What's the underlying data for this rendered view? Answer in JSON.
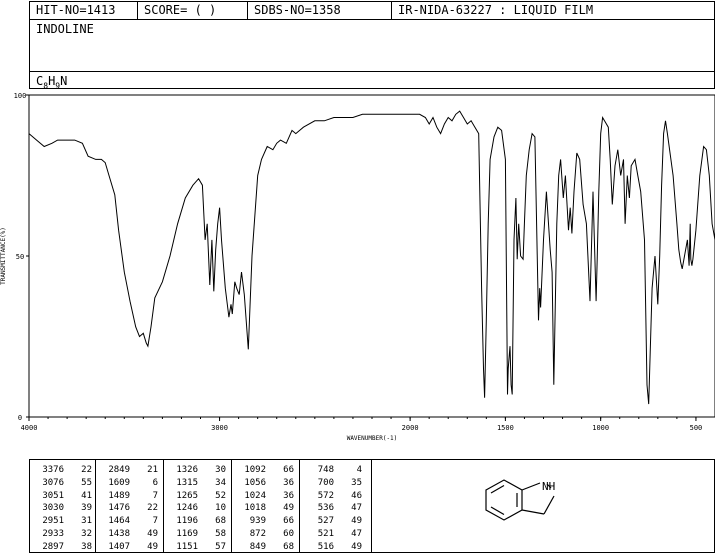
{
  "header": {
    "hit_no": "HIT-NO=1413",
    "score": "SCORE=  (  )",
    "sdbs_no": "SDBS-NO=1358",
    "ir_id": "IR-NIDA-63227 : LIQUID FILM",
    "compound_name": "INDOLINE",
    "formula_base": "C",
    "formula_parts": [
      {
        "t": "C",
        "s": false
      },
      {
        "t": "8",
        "s": true
      },
      {
        "t": "H",
        "s": false
      },
      {
        "t": "9",
        "s": true
      },
      {
        "t": "N",
        "s": false
      }
    ]
  },
  "chart_data": {
    "type": "line",
    "title": "",
    "xlabel": "WAVENUMBER(-1)",
    "ylabel": "TRANSMITTANCE(%)",
    "xlim": [
      4000,
      400
    ],
    "ylim": [
      0,
      100
    ],
    "x_ticks": [
      4000,
      3000,
      2000,
      1500,
      1000,
      500
    ],
    "x_tick_labels": [
      "4000",
      "3000",
      "2000",
      "1500",
      "1000",
      "500"
    ],
    "y_ticks": [
      0,
      50,
      100
    ],
    "y_tick_labels": [
      "0",
      "50",
      "100"
    ],
    "series": [
      {
        "name": "",
        "color": "#000000",
        "points": [
          [
            4000,
            88
          ],
          [
            3960,
            86
          ],
          [
            3920,
            84
          ],
          [
            3880,
            85
          ],
          [
            3850,
            86
          ],
          [
            3800,
            86
          ],
          [
            3760,
            86
          ],
          [
            3720,
            85
          ],
          [
            3690,
            81
          ],
          [
            3650,
            80
          ],
          [
            3620,
            80
          ],
          [
            3600,
            79
          ],
          [
            3580,
            75
          ],
          [
            3550,
            69
          ],
          [
            3530,
            58
          ],
          [
            3500,
            45
          ],
          [
            3470,
            36
          ],
          [
            3440,
            28
          ],
          [
            3420,
            25
          ],
          [
            3400,
            26
          ],
          [
            3385,
            23
          ],
          [
            3376,
            22
          ],
          [
            3360,
            28
          ],
          [
            3340,
            37
          ],
          [
            3300,
            42
          ],
          [
            3260,
            50
          ],
          [
            3220,
            60
          ],
          [
            3180,
            68
          ],
          [
            3140,
            72
          ],
          [
            3110,
            74
          ],
          [
            3090,
            72
          ],
          [
            3076,
            55
          ],
          [
            3065,
            60
          ],
          [
            3051,
            41
          ],
          [
            3040,
            55
          ],
          [
            3030,
            39
          ],
          [
            3020,
            52
          ],
          [
            3010,
            60
          ],
          [
            3000,
            65
          ],
          [
            2990,
            55
          ],
          [
            2970,
            40
          ],
          [
            2951,
            31
          ],
          [
            2940,
            35
          ],
          [
            2933,
            32
          ],
          [
            2920,
            42
          ],
          [
            2910,
            40
          ],
          [
            2897,
            38
          ],
          [
            2885,
            45
          ],
          [
            2870,
            38
          ],
          [
            2849,
            21
          ],
          [
            2830,
            50
          ],
          [
            2800,
            75
          ],
          [
            2780,
            80
          ],
          [
            2750,
            84
          ],
          [
            2720,
            83
          ],
          [
            2700,
            85
          ],
          [
            2680,
            86
          ],
          [
            2650,
            85
          ],
          [
            2620,
            89
          ],
          [
            2600,
            88
          ],
          [
            2560,
            90
          ],
          [
            2500,
            92
          ],
          [
            2450,
            92
          ],
          [
            2400,
            93
          ],
          [
            2350,
            93
          ],
          [
            2300,
            93
          ],
          [
            2250,
            94
          ],
          [
            2200,
            94
          ],
          [
            2150,
            94
          ],
          [
            2100,
            94
          ],
          [
            2050,
            94
          ],
          [
            2000,
            94
          ],
          [
            1950,
            94
          ],
          [
            1920,
            93
          ],
          [
            1900,
            91
          ],
          [
            1880,
            93
          ],
          [
            1860,
            90
          ],
          [
            1840,
            88
          ],
          [
            1820,
            91
          ],
          [
            1800,
            93
          ],
          [
            1780,
            92
          ],
          [
            1760,
            94
          ],
          [
            1740,
            95
          ],
          [
            1720,
            93
          ],
          [
            1700,
            91
          ],
          [
            1680,
            92
          ],
          [
            1660,
            90
          ],
          [
            1640,
            88
          ],
          [
            1625,
            40
          ],
          [
            1615,
            15
          ],
          [
            1609,
            6
          ],
          [
            1600,
            30
          ],
          [
            1590,
            60
          ],
          [
            1580,
            80
          ],
          [
            1560,
            87
          ],
          [
            1540,
            90
          ],
          [
            1520,
            89
          ],
          [
            1500,
            80
          ],
          [
            1489,
            7
          ],
          [
            1485,
            15
          ],
          [
            1476,
            22
          ],
          [
            1470,
            10
          ],
          [
            1464,
            7
          ],
          [
            1455,
            55
          ],
          [
            1445,
            68
          ],
          [
            1438,
            49
          ],
          [
            1430,
            60
          ],
          [
            1420,
            50
          ],
          [
            1407,
            49
          ],
          [
            1400,
            60
          ],
          [
            1390,
            75
          ],
          [
            1375,
            83
          ],
          [
            1360,
            88
          ],
          [
            1345,
            87
          ],
          [
            1326,
            30
          ],
          [
            1320,
            40
          ],
          [
            1315,
            34
          ],
          [
            1300,
            55
          ],
          [
            1285,
            70
          ],
          [
            1265,
            52
          ],
          [
            1255,
            45
          ],
          [
            1246,
            10
          ],
          [
            1230,
            60
          ],
          [
            1220,
            75
          ],
          [
            1210,
            80
          ],
          [
            1196,
            68
          ],
          [
            1185,
            75
          ],
          [
            1169,
            58
          ],
          [
            1160,
            65
          ],
          [
            1151,
            57
          ],
          [
            1140,
            70
          ],
          [
            1125,
            82
          ],
          [
            1110,
            80
          ],
          [
            1092,
            66
          ],
          [
            1075,
            60
          ],
          [
            1056,
            36
          ],
          [
            1040,
            70
          ],
          [
            1024,
            36
          ],
          [
            1018,
            49
          ],
          [
            1010,
            70
          ],
          [
            1000,
            88
          ],
          [
            990,
            93
          ],
          [
            980,
            92
          ],
          [
            960,
            90
          ],
          [
            950,
            80
          ],
          [
            939,
            66
          ],
          [
            925,
            78
          ],
          [
            910,
            83
          ],
          [
            895,
            75
          ],
          [
            880,
            80
          ],
          [
            872,
            60
          ],
          [
            860,
            75
          ],
          [
            849,
            68
          ],
          [
            840,
            78
          ],
          [
            820,
            80
          ],
          [
            805,
            75
          ],
          [
            790,
            70
          ],
          [
            770,
            55
          ],
          [
            757,
            10
          ],
          [
            748,
            4
          ],
          [
            740,
            20
          ],
          [
            730,
            40
          ],
          [
            715,
            50
          ],
          [
            700,
            35
          ],
          [
            690,
            50
          ],
          [
            680,
            72
          ],
          [
            670,
            88
          ],
          [
            660,
            92
          ],
          [
            650,
            88
          ],
          [
            620,
            75
          ],
          [
            600,
            60
          ],
          [
            590,
            52
          ],
          [
            580,
            48
          ],
          [
            572,
            46
          ],
          [
            560,
            50
          ],
          [
            545,
            55
          ],
          [
            536,
            47
          ],
          [
            530,
            60
          ],
          [
            527,
            49
          ],
          [
            521,
            47
          ],
          [
            516,
            49
          ],
          [
            500,
            58
          ],
          [
            480,
            75
          ],
          [
            460,
            84
          ],
          [
            445,
            83
          ],
          [
            430,
            75
          ],
          [
            415,
            60
          ],
          [
            400,
            55
          ]
        ]
      }
    ]
  },
  "peak_table": {
    "columns": [
      [
        [
          3376,
          22
        ],
        [
          3076,
          55
        ],
        [
          3051,
          41
        ],
        [
          3030,
          39
        ],
        [
          2951,
          31
        ],
        [
          2933,
          32
        ],
        [
          2897,
          38
        ]
      ],
      [
        [
          2849,
          21
        ],
        [
          1609,
          6
        ],
        [
          1489,
          7
        ],
        [
          1476,
          22
        ],
        [
          1464,
          7
        ],
        [
          1438,
          49
        ],
        [
          1407,
          49
        ]
      ],
      [
        [
          1326,
          30
        ],
        [
          1315,
          34
        ],
        [
          1265,
          52
        ],
        [
          1246,
          10
        ],
        [
          1196,
          68
        ],
        [
          1169,
          58
        ],
        [
          1151,
          57
        ]
      ],
      [
        [
          1092,
          66
        ],
        [
          1056,
          36
        ],
        [
          1024,
          36
        ],
        [
          1018,
          49
        ],
        [
          939,
          66
        ],
        [
          872,
          60
        ],
        [
          849,
          68
        ]
      ],
      [
        [
          748,
          4
        ],
        [
          700,
          35
        ],
        [
          572,
          46
        ],
        [
          536,
          47
        ],
        [
          527,
          49
        ],
        [
          521,
          47
        ],
        [
          516,
          49
        ]
      ]
    ]
  },
  "structure": {
    "label": "NH"
  }
}
